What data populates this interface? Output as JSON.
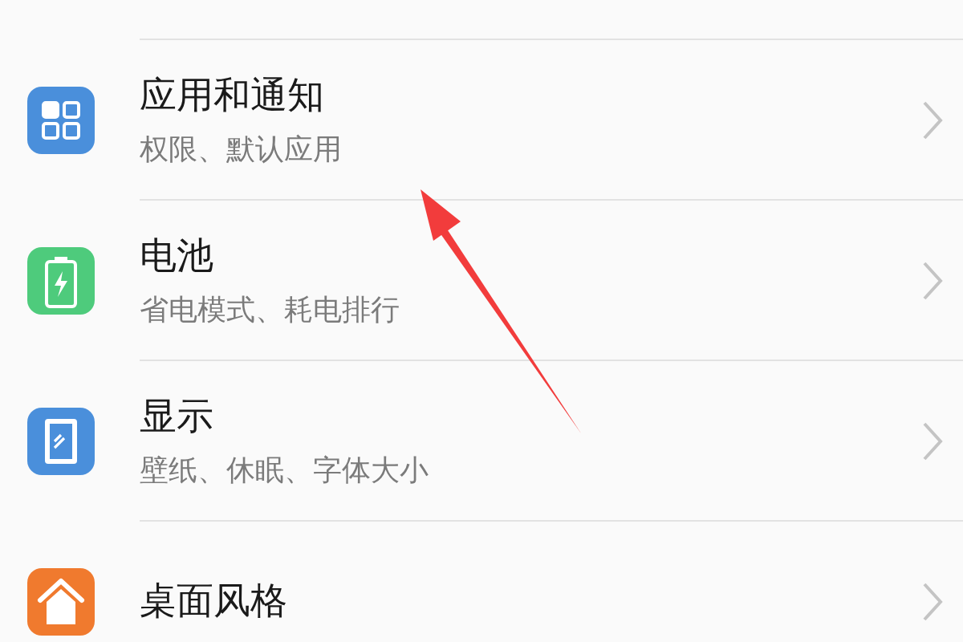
{
  "settings": [
    {
      "kind": "apps",
      "title": "应用和通知",
      "subtitle": "权限、默认应用"
    },
    {
      "kind": "battery",
      "title": "电池",
      "subtitle": "省电模式、耗电排行"
    },
    {
      "kind": "display",
      "title": "显示",
      "subtitle": "壁纸、休眠、字体大小"
    },
    {
      "kind": "home",
      "title": "桌面风格"
    }
  ]
}
